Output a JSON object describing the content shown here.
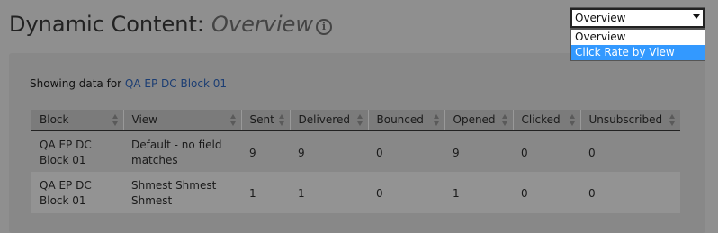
{
  "header": {
    "title": "Dynamic Content:",
    "subtitle": "Overview",
    "info_icon": "info-icon"
  },
  "view_select": {
    "selected": "Overview",
    "options": [
      "Overview",
      "Click Rate by View"
    ],
    "highlighted": "Click Rate by View"
  },
  "panel": {
    "showing_prefix": "Showing data for",
    "showing_link": "QA EP DC Block 01"
  },
  "table": {
    "columns": [
      "Block",
      "View",
      "Sent",
      "Delivered",
      "Bounced",
      "Opened",
      "Clicked",
      "Unsubscribed"
    ],
    "rows": [
      {
        "block": "QA EP DC Block 01",
        "view": "Default - no field matches",
        "sent": "9",
        "delivered": "9",
        "bounced": "0",
        "opened": "9",
        "clicked": "0",
        "unsubscribed": "0"
      },
      {
        "block": "QA EP DC Block 01",
        "view": "Shmest Shmest Shmest",
        "sent": "1",
        "delivered": "1",
        "bounced": "0",
        "opened": "1",
        "clicked": "0",
        "unsubscribed": "0"
      }
    ]
  },
  "colors": {
    "overlay_background": "#8f8f8f",
    "link": "#1b3d73",
    "highlight": "#3399ff"
  }
}
